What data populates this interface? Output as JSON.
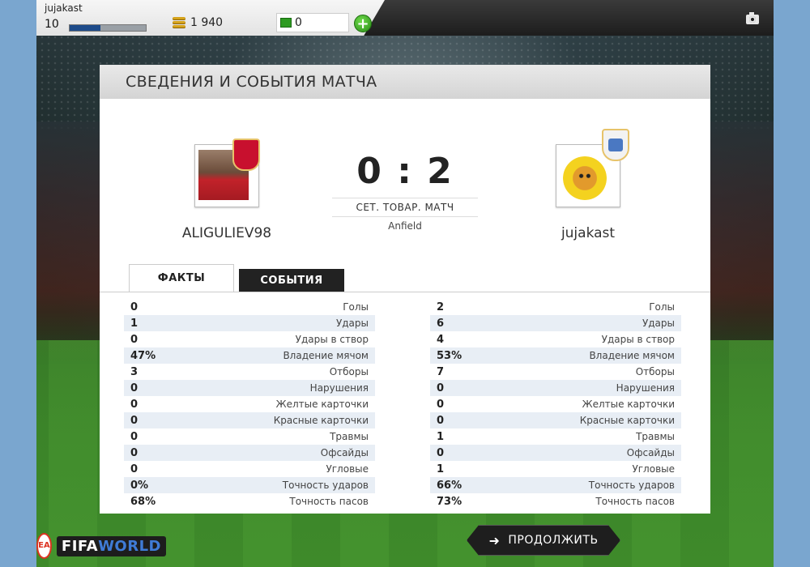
{
  "user": {
    "name": "jujakast",
    "level": "10",
    "xp_fraction": 0.4,
    "coins": "1 940",
    "points": "0"
  },
  "panel": {
    "title": "СВЕДЕНИЯ И СОБЫТИЯ МАТЧА"
  },
  "match": {
    "home_team": "ALIGULIEV98",
    "away_team": "jujakast",
    "score": "0 : 2",
    "type": "СЕТ. ТОВАР. МАТЧ",
    "venue": "Anfield"
  },
  "tabs": {
    "facts": "ФАКТЫ",
    "events": "СОБЫТИЯ"
  },
  "stats": [
    {
      "label": "Голы",
      "home": "0",
      "away": "2"
    },
    {
      "label": "Удары",
      "home": "1",
      "away": "6"
    },
    {
      "label": "Удары в створ",
      "home": "0",
      "away": "4"
    },
    {
      "label": "Владение мячом",
      "home": "47%",
      "away": "53%"
    },
    {
      "label": "Отборы",
      "home": "3",
      "away": "7"
    },
    {
      "label": "Нарушения",
      "home": "0",
      "away": "0"
    },
    {
      "label": "Желтые карточки",
      "home": "0",
      "away": "0"
    },
    {
      "label": "Красные карточки",
      "home": "0",
      "away": "0"
    },
    {
      "label": "Травмы",
      "home": "0",
      "away": "1"
    },
    {
      "label": "Офсайды",
      "home": "0",
      "away": "0"
    },
    {
      "label": "Угловые",
      "home": "0",
      "away": "1"
    },
    {
      "label": "Точность ударов",
      "home": "0%",
      "away": "66%"
    },
    {
      "label": "Точность пасов",
      "home": "68%",
      "away": "73%"
    }
  ],
  "bottom": {
    "continue_label": "ПРОДОЛЖИТЬ",
    "ea_badge": "EA",
    "logo_fifa": "FIFA",
    "logo_world": "WORLD"
  },
  "icons": {
    "coins": "coin-stack-icon",
    "points": "fifa-points-icon",
    "add": "plus-icon",
    "camera": "camera-icon",
    "continue": "arrow-right-icon"
  },
  "colors": {
    "xp_fill": "#1d4b8a",
    "add_button": "#2a8c18",
    "events_tab": "#222222",
    "alt_row": "#e8eef5"
  }
}
